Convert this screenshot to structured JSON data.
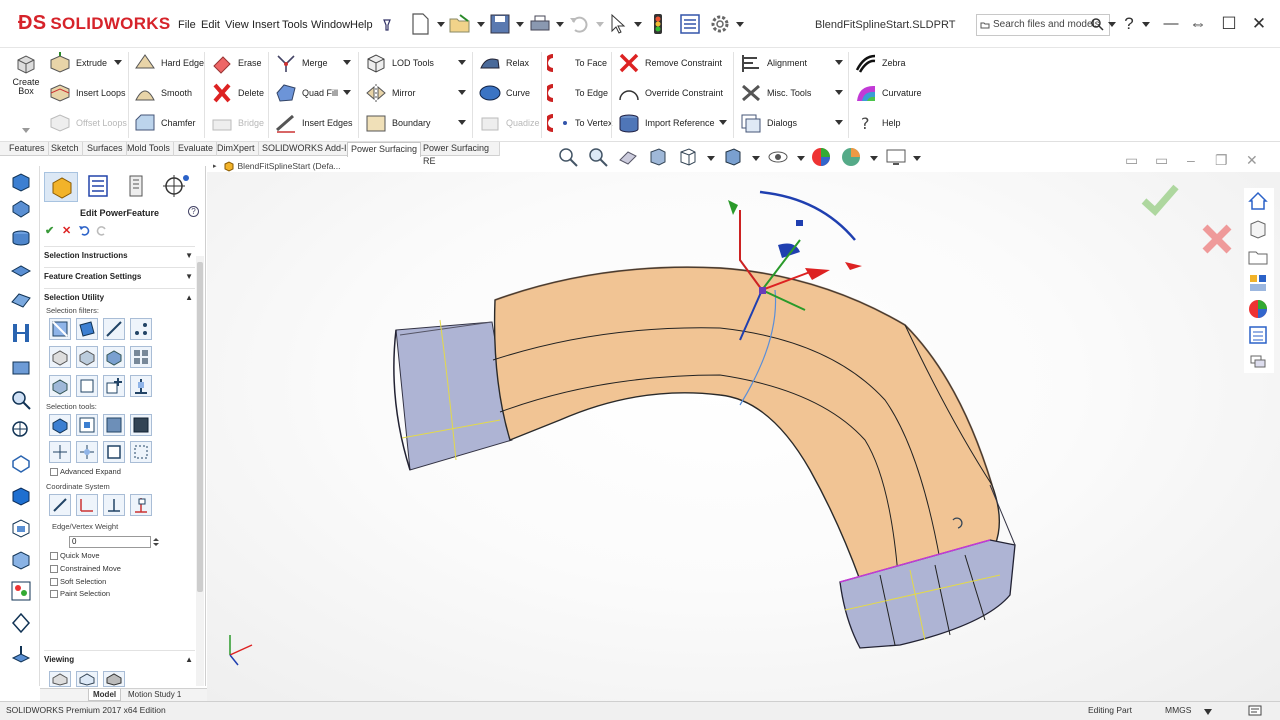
{
  "app": {
    "brand": "SOLIDWORKS",
    "document_title": "BlendFitSplineStart.SLDPRT",
    "accent_color": "#d6232a"
  },
  "menu": [
    "File",
    "Edit",
    "View",
    "Insert",
    "Tools",
    "Window",
    "Help"
  ],
  "search": {
    "placeholder": "Search files and models"
  },
  "window_controls": {
    "help": "?",
    "dock": "⇔",
    "minimize": "—",
    "maximize": "☐",
    "close": "✕"
  },
  "ribbon": {
    "create_box": "Create Box",
    "group1": {
      "extrude": "Extrude",
      "insert_loops": "Insert Loops",
      "offset_loops": "Offset Loops"
    },
    "group2": {
      "hard_edge": "Hard Edge",
      "smooth": "Smooth",
      "chamfer": "Chamfer"
    },
    "group3": {
      "erase": "Erase",
      "delete": "Delete",
      "bridge": "Bridge"
    },
    "group4": {
      "merge": "Merge",
      "quad_fill": "Quad Fill",
      "insert_edges": "Insert Edges"
    },
    "group5": {
      "lod_tools": "LOD Tools",
      "mirror": "Mirror",
      "boundary": "Boundary"
    },
    "group6": {
      "relax": "Relax",
      "curve": "Curve",
      "quadize": "Quadize"
    },
    "group7": {
      "to_face": "To Face",
      "to_edge": "To Edge",
      "to_vertex": "To Vertex"
    },
    "group8": {
      "remove_constraint": "Remove Constraint",
      "override_constraint": "Override Constraint",
      "import_reference": "Import Reference"
    },
    "group9": {
      "alignment": "Alignment",
      "misc_tools": "Misc. Tools",
      "dialogs": "Dialogs"
    },
    "group10": {
      "zebra": "Zebra",
      "curvature": "Curvature",
      "help": "Help"
    }
  },
  "command_tabs": [
    "Features",
    "Sketch",
    "Surfaces",
    "Mold Tools",
    "Evaluate",
    "DimXpert",
    "SOLIDWORKS Add-Ins",
    "Power Surfacing",
    "Power Surfacing RE"
  ],
  "active_tab": "Power Surfacing",
  "feature_tree": {
    "breadcrumb": "BlendFitSplineStart  (Defa..."
  },
  "property_manager": {
    "title": "Edit PowerFeature",
    "ok": "✔",
    "cancel": "✕",
    "help": "?",
    "sections": {
      "selection_instructions": "Selection Instructions",
      "feature_creation_settings": "Feature Creation Settings",
      "selection_utility": "Selection Utility",
      "viewing": "Viewing"
    },
    "selection_filters_label": "Selection filters:",
    "selection_tools_label": "Selection tools:",
    "advanced_expand": "Advanced Expand",
    "coordinate_system": "Coordinate System",
    "edge_vertex_weight_label": "Edge/Vertex Weight",
    "edge_vertex_weight_value": "0",
    "options": [
      "Quick Move",
      "Constrained Move",
      "Soft Selection",
      "Paint Selection"
    ]
  },
  "bottom_tabs": [
    "Model",
    "Motion Study 1"
  ],
  "status": {
    "edition": "SOLIDWORKS Premium 2017 x64 Edition",
    "mode": "Editing Part",
    "units": "MMGS"
  },
  "colors": {
    "model_surface": "#f3c596",
    "model_cage": "#a0a8cc",
    "confirm_green": "#7fbf6a",
    "cancel_red": "#e36c6c"
  }
}
